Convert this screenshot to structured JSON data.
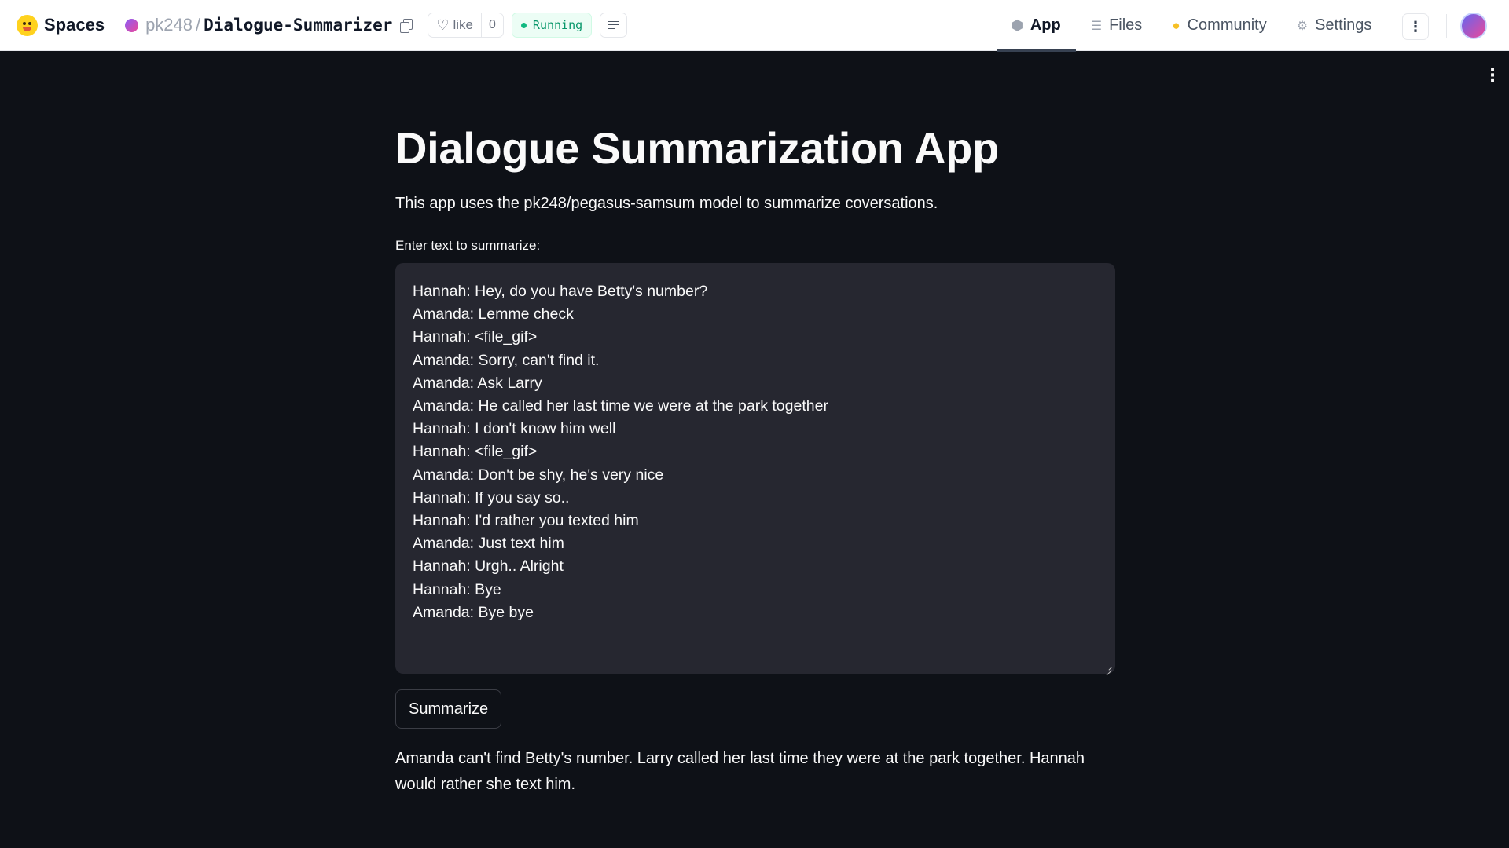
{
  "header": {
    "brand": "Spaces",
    "owner": "pk248",
    "separator": "/",
    "space_name": "Dialogue-Summarizer",
    "like_label": "like",
    "like_count": "0",
    "status": "Running",
    "tabs": [
      {
        "label": "App",
        "icon": "cube-icon"
      },
      {
        "label": "Files",
        "icon": "files-icon"
      },
      {
        "label": "Community",
        "icon": "community-icon"
      },
      {
        "label": "Settings",
        "icon": "gear-icon"
      }
    ],
    "status_color": "#059669"
  },
  "app": {
    "title": "Dialogue Summarization App",
    "description": "This app uses the pk248/pegasus-samsum model to summarize coversations.",
    "input_label": "Enter text to summarize:",
    "input_value": "Hannah: Hey, do you have Betty's number?\nAmanda: Lemme check\nHannah: <file_gif>\nAmanda: Sorry, can't find it.\nAmanda: Ask Larry\nAmanda: He called her last time we were at the park together\nHannah: I don't know him well\nHannah: <file_gif>\nAmanda: Don't be shy, he's very nice\nHannah: If you say so..\nHannah: I'd rather you texted him\nAmanda: Just text him\nHannah: Urgh.. Alright\nHannah: Bye\nAmanda: Bye bye",
    "button_label": "Summarize",
    "summary": "Amanda can't find Betty's number. Larry called her last time they were at the park together. Hannah would rather she text him.",
    "background_color": "#0e1117",
    "textarea_color": "#262730"
  }
}
